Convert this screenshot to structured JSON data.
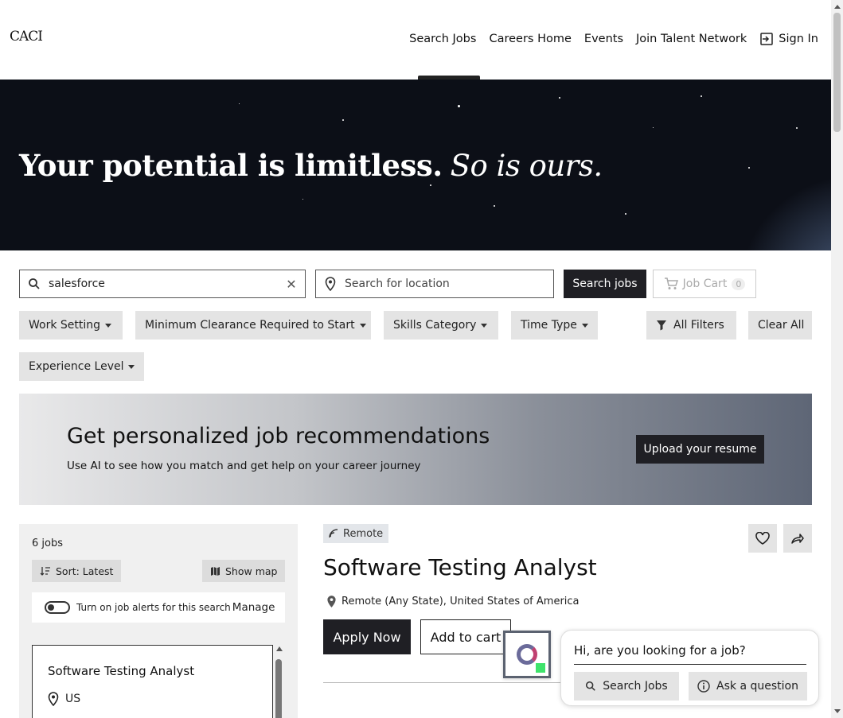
{
  "header": {
    "logo": "CACI",
    "nav": [
      "Search Jobs",
      "Careers Home",
      "Events",
      "Join Talent Network"
    ],
    "sign_in": "Sign In"
  },
  "hero": {
    "title_bold": "Your potential is limitless.",
    "title_italic": "So is ours."
  },
  "search": {
    "keyword_value": "salesforce",
    "location_placeholder": "Search for location",
    "search_button": "Search jobs",
    "cart_label": "Job Cart",
    "cart_count": "0"
  },
  "filters": {
    "work_setting": "Work Setting",
    "clearance": "Minimum Clearance Required to Start",
    "skills": "Skills Category",
    "time_type": "Time Type",
    "all_filters": "All Filters",
    "clear_all": "Clear All",
    "experience": "Experience Level"
  },
  "banner": {
    "title": "Get personalized job recommendations",
    "subtitle": "Use AI to see how you match and get help on your career journey",
    "button": "Upload your resume"
  },
  "results": {
    "count": "6 jobs",
    "sort": "Sort: Latest",
    "map": "Show map",
    "alert_text": "Turn on job alerts for this search",
    "manage": "Manage",
    "card_title": "Software Testing Analyst",
    "card_location": "US"
  },
  "job": {
    "badge": "Remote",
    "title": "Software Testing Analyst",
    "location": "Remote (Any State), United States of America",
    "apply": "Apply Now",
    "add_cart": "Add to cart"
  },
  "chat": {
    "question": "Hi, are you looking for a job?",
    "search_jobs": "Search Jobs",
    "ask": "Ask a question"
  }
}
